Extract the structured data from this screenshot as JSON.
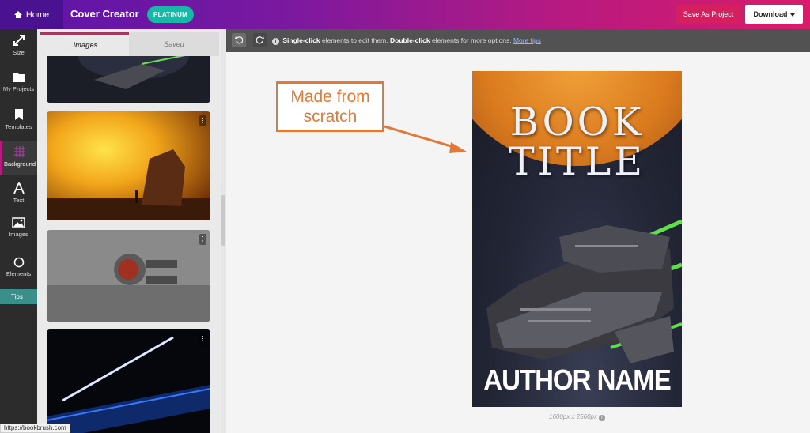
{
  "topbar": {
    "home_label": "Home",
    "app_title": "Cover Creator",
    "plan_badge": "PLATINUM",
    "save_label": "Save As Project",
    "download_label": "Download"
  },
  "leftnav": {
    "items": [
      {
        "label": "Size",
        "icon": "resize-icon"
      },
      {
        "label": "My Projects",
        "icon": "folder-icon"
      },
      {
        "label": "Templates",
        "icon": "bookmark-icon"
      },
      {
        "label": "Background",
        "icon": "grid-icon"
      },
      {
        "label": "Text",
        "icon": "text-icon"
      },
      {
        "label": "Images",
        "icon": "image-icon"
      },
      {
        "label": "Elements",
        "icon": "circle-icon"
      }
    ],
    "tips_label": "Tips"
  },
  "panel": {
    "tabs": [
      {
        "label": "Images",
        "active": true
      },
      {
        "label": "Saved",
        "active": false
      }
    ],
    "thumbnails": [
      {
        "subject": "spaceship over dark planet"
      },
      {
        "subject": "glowing sun behind rock"
      },
      {
        "subject": "grey hover vehicle"
      },
      {
        "subject": "subway station at night"
      }
    ]
  },
  "canvas_toolbar": {
    "single_click": "Single-click",
    "single_click_rest": "elements to edit them.",
    "double_click": "Double-click",
    "double_click_rest": "elements for more options.",
    "more_tips": "More tips"
  },
  "annotation": {
    "text": "Made from scratch",
    "color": "#e07a3a"
  },
  "cover": {
    "title_line1": "BOOK",
    "title_line2": "TITLE",
    "author": "AUTHOR NAME",
    "dimensions": "1600px x 2560px"
  },
  "status_bar": {
    "url": "https://bookbrush.com"
  },
  "colors": {
    "brand_purple": "#5b14a8",
    "brand_pink": "#d61f5e",
    "badge_teal": "#18b8a6",
    "tips_teal": "#3a8f8a"
  }
}
